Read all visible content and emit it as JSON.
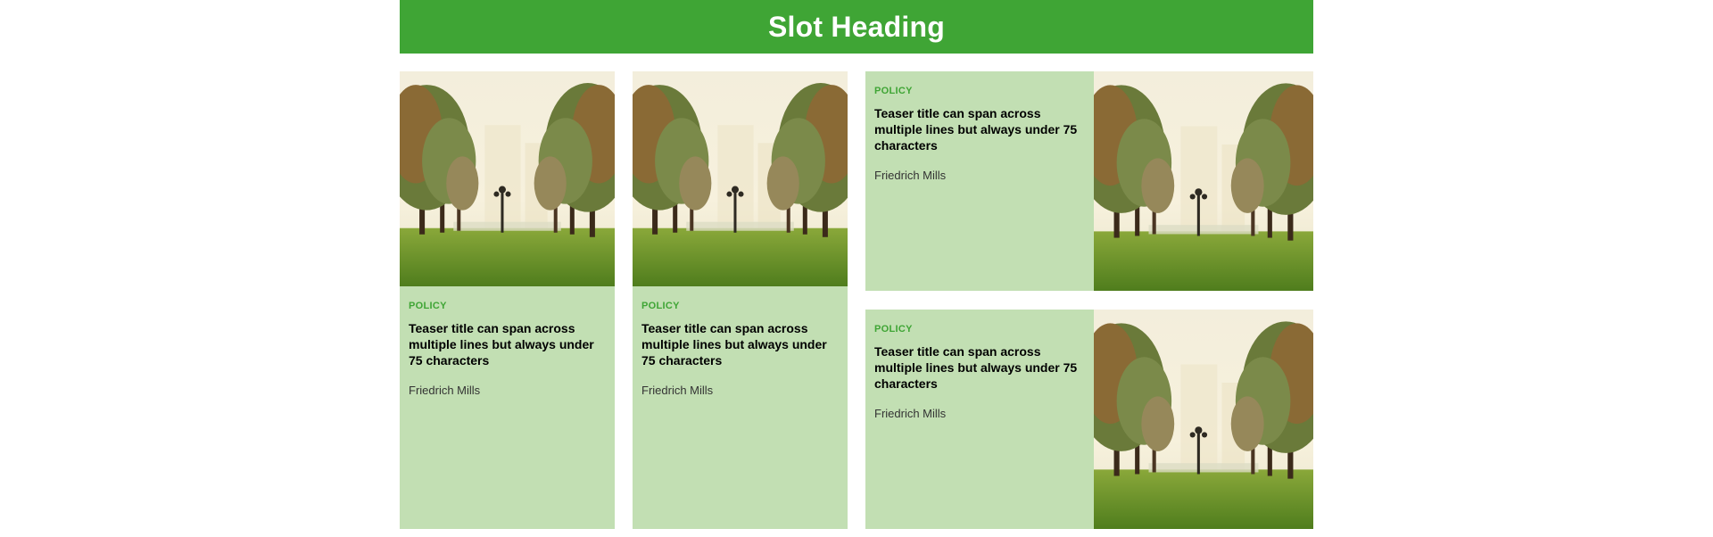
{
  "slot": {
    "heading": "Slot Heading"
  },
  "colors": {
    "accent": "#3fa535",
    "card_background": "#c2dfb3"
  },
  "cards": [
    {
      "category": "POLICY",
      "title": "Teaser title can span across multiple lines but always under 75 characters",
      "author": "Friedrich Mills",
      "image_icon": "park-palm-trees-image"
    },
    {
      "category": "POLICY",
      "title": "Teaser title can span across multiple lines but always under 75 characters",
      "author": "Friedrich Mills",
      "image_icon": "park-palm-trees-image"
    },
    {
      "category": "POLICY",
      "title": "Teaser title can span across multiple lines but always under 75 characters",
      "author": "Friedrich Mills",
      "image_icon": "park-palm-trees-image"
    },
    {
      "category": "POLICY",
      "title": "Teaser title can span across multiple lines but always under 75 characters",
      "author": "Friedrich Mills",
      "image_icon": "park-palm-trees-image"
    }
  ]
}
